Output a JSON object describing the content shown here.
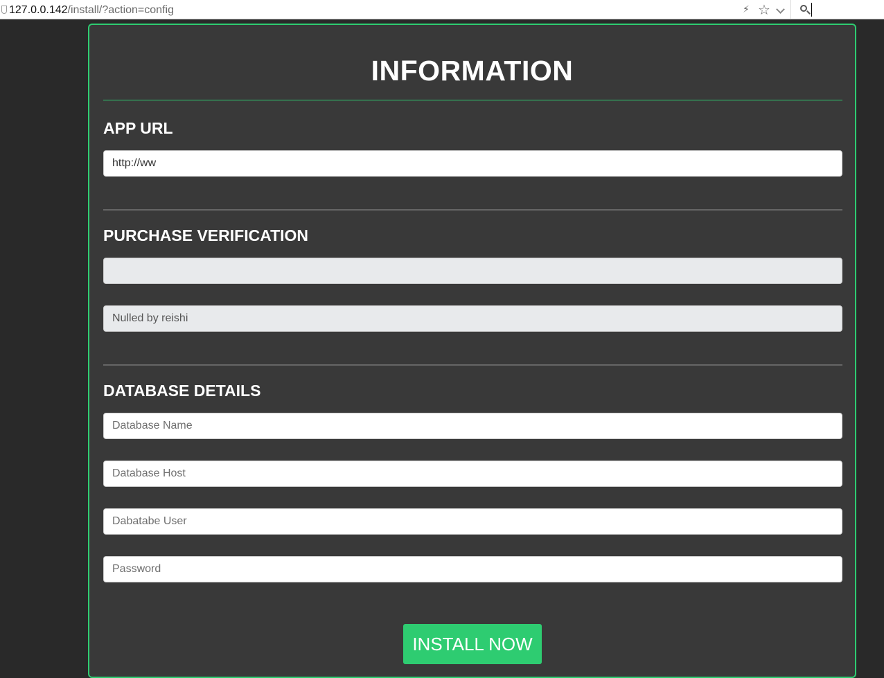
{
  "browser": {
    "url_host": "127.0.0.142",
    "url_path": "/install/?action=config",
    "icons": [
      "shield-icon",
      "bolt-icon",
      "star-icon",
      "dropdown-icon",
      "search-icon"
    ],
    "bolt_glyph": "⚡",
    "star_glyph": "☆"
  },
  "panel": {
    "title": "INFORMATION",
    "accent_color": "#2ecc71",
    "background_color": "#393939"
  },
  "app_url": {
    "heading": "APP URL",
    "value": "http://ww"
  },
  "purchase": {
    "heading": "PURCHASE VERIFICATION",
    "code_value": "",
    "license_value": "Nulled by reishi"
  },
  "database": {
    "heading": "DATABASE DETAILS",
    "name_placeholder": "Database Name",
    "host_placeholder": "Database Host",
    "user_placeholder": "Dabatabe User",
    "password_placeholder": "Password"
  },
  "install_button": {
    "label": "INSTALL NOW"
  }
}
